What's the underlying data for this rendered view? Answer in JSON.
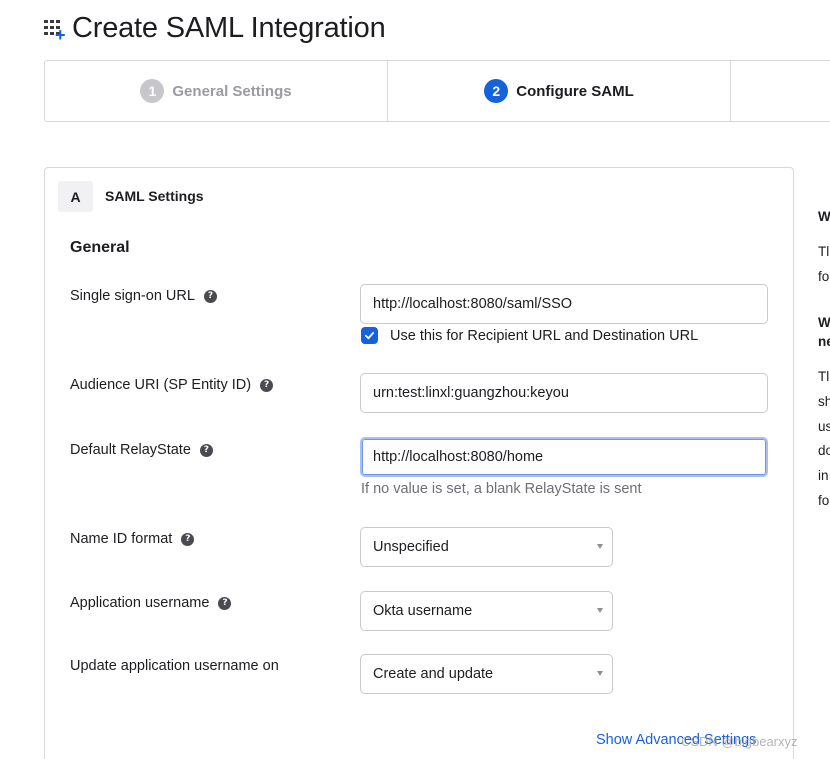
{
  "header": {
    "title": "Create SAML Integration",
    "icon": "app-add-icon"
  },
  "stepper": {
    "steps": [
      {
        "number": "1",
        "label": "General Settings",
        "state": "done"
      },
      {
        "number": "2",
        "label": "Configure SAML",
        "state": "active"
      }
    ]
  },
  "section": {
    "badge": "A",
    "title": "SAML Settings",
    "group_title": "General"
  },
  "fields": {
    "sso_url": {
      "label": "Single sign-on URL",
      "value": "http://localhost:8080/saml/SSO"
    },
    "recipient_checkbox": {
      "label": "Use this for Recipient URL and Destination URL",
      "checked": true
    },
    "audience_uri": {
      "label": "Audience URI (SP Entity ID)",
      "value": "urn:test:linxl:guangzhou:keyou"
    },
    "relay_state": {
      "label": "Default RelayState",
      "value": "http://localhost:8080/home",
      "hint": "If no value is set, a blank RelayState is sent"
    },
    "name_id_format": {
      "label": "Name ID format",
      "selected": "Unspecified"
    },
    "app_username": {
      "label": "Application username",
      "selected": "Okta username"
    },
    "update_username_on": {
      "label": "Update application username on",
      "selected": "Create and update"
    }
  },
  "links": {
    "advanced": "Show Advanced Settings"
  },
  "watermark": "CSDN @bigbearxyz",
  "side_panel": {
    "fragments": [
      "W",
      "Tl",
      "fo",
      "W",
      "ne",
      "Tl",
      "sh",
      "us",
      "do",
      "in",
      "fo"
    ]
  },
  "colors": {
    "accent": "#1662dd",
    "border": "#d7d7dc",
    "muted": "#6e6e78"
  }
}
